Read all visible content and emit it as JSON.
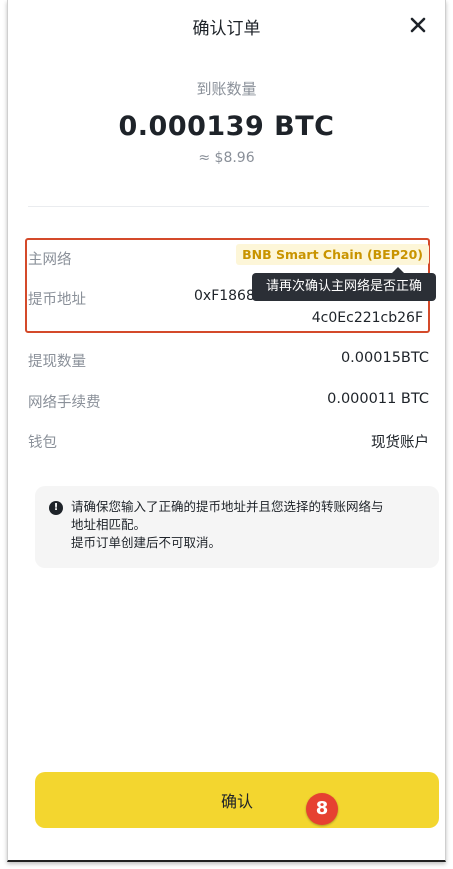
{
  "header": {
    "title": "确认订单",
    "close_icon": "close-icon"
  },
  "amount": {
    "label": "到账数量",
    "value": "0.000139 BTC",
    "fiat": "≈ $8.96"
  },
  "details": {
    "network": {
      "label": "主网络",
      "value": "BNB Smart Chain (BEP20)"
    },
    "address": {
      "label": "提币地址",
      "line1": "0xF1868",
      "line2": "4c0Ec221cb26F"
    },
    "tooltip": "请再次确认主网络是否正确",
    "amount": {
      "label": "提现数量",
      "value": "0.00015BTC"
    },
    "fee": {
      "label": "网络手续费",
      "value": "0.000011 BTC"
    },
    "wallet": {
      "label": "钱包",
      "value": "现货账户"
    }
  },
  "notice": {
    "icon": "exclamation-icon",
    "line1": "请确保您输入了正确的提币地址并且您选择的转账网络与",
    "line2": "地址相匹配。",
    "line3": "提币订单创建后不可取消。"
  },
  "confirm_button": {
    "label": "确认"
  },
  "step_badge": "8",
  "colors": {
    "accent": "#f3d62f",
    "highlight_border": "#d44a2a",
    "badge_text": "#c99400",
    "step_badge": "#e64131"
  }
}
